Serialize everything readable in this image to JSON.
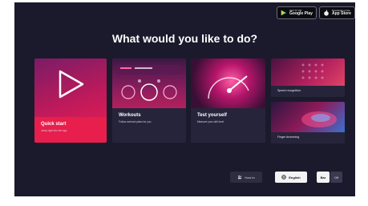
{
  "store_badges": [
    {
      "small": "GET IT ON",
      "big": "Google Play",
      "icon": "google-play-icon"
    },
    {
      "small": "Download on the",
      "big": "App Store",
      "icon": "apple-icon"
    }
  ],
  "heading": "What would you like to do?",
  "cards": {
    "quick_start": {
      "title": "Quick start",
      "subtitle": "Jump right into the app"
    },
    "workouts": {
      "title": "Workouts",
      "subtitle": "Follow workout plans for you"
    },
    "test_yourself": {
      "title": "Test yourself",
      "subtitle": "Measure your skill level"
    },
    "speed": {
      "title": "Speed recognition"
    },
    "drumming": {
      "title": "Finger drumming"
    }
  },
  "controls": {
    "help_label": "How to",
    "language_label": "English",
    "mode_on_label": "Bar",
    "mode_off_label": "Off"
  },
  "colors": {
    "background": "#1b1a2c",
    "accent": "#e81e4c",
    "card": "#26243a"
  }
}
